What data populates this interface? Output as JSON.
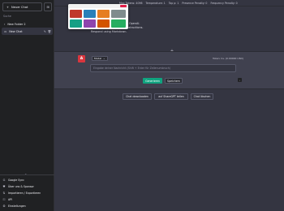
{
  "sidebar": {
    "new_chat_label": "Neuer Chat",
    "search_placeholder": "Suche",
    "items": [
      {
        "label": "New Folder 2"
      },
      {
        "label": "New Chat"
      }
    ],
    "bottom": [
      {
        "label": "Google Sync",
        "icon": "google-icon"
      },
      {
        "label": "Über uns & Sponsor",
        "icon": "heart-icon"
      },
      {
        "label": "Importieren / Exportieren",
        "icon": "import-export-icon"
      },
      {
        "label": "API",
        "icon": "key-icon"
      },
      {
        "label": "Einstellungen",
        "icon": "gear-icon"
      }
    ]
  },
  "topbar": {
    "items": [
      "Max Tokens: 4096",
      "Temperature: 1",
      "Top p: 1",
      "Presence Penalty: 0",
      "Frequency Penalty: 0"
    ]
  },
  "system_prompt": {
    "lines": [
      "language model trained by OpenAI.",
      "Carefully heed the user's instructions.",
      "Respond using Markdown."
    ]
  },
  "message": {
    "avatar_letter": "A",
    "model_label": "Model",
    "tokens_label": "Token: 0+ (0.00000 USD)",
    "input_placeholder": "Eingabe deiner Nachricht (Shift + Enter für Zeilenumbruch)",
    "generate_label": "Generieren",
    "save_label": "Speichern"
  },
  "actions": {
    "download_label": "Chat downloaden",
    "sharegpt_label": "auf ShareGPT teilen",
    "clear_label": "Chat löschen"
  },
  "colors": {
    "accent": "#10a37f",
    "avatar": "#d9363e",
    "sidebar_bg": "#202123",
    "main_bg": "#343541"
  }
}
